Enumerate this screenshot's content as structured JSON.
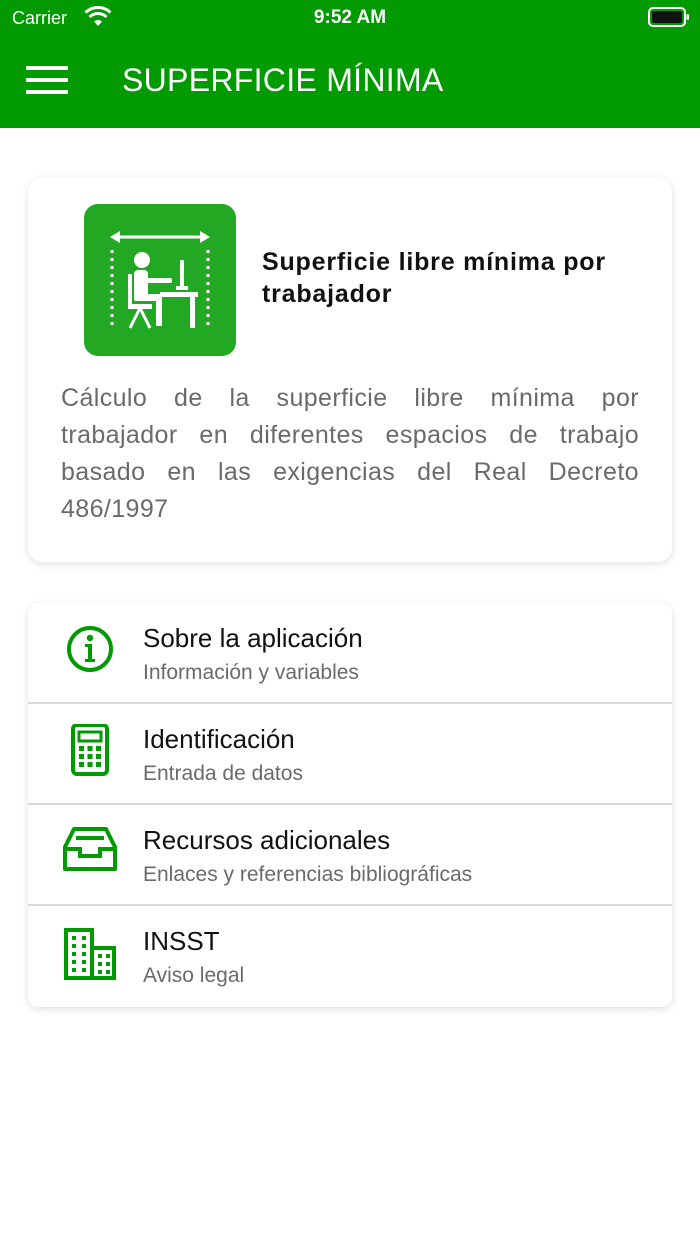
{
  "status_bar": {
    "carrier": "Carrier",
    "time": "9:52 AM"
  },
  "header": {
    "title": "SUPERFICIE MÍNIMA"
  },
  "colors": {
    "brand": "#019a01",
    "icon_green": "#22a822"
  },
  "card": {
    "icon": "workstation-space-icon",
    "title": "Superficie libre mínima por trabajador",
    "description": "Cálculo de la superficie libre mínima por trabajador en diferentes espacios de trabajo basado en las exigencias del Real Decreto 486/1997"
  },
  "menu": {
    "items": [
      {
        "icon": "info-icon",
        "title": "Sobre la aplicación",
        "subtitle": "Información y variables"
      },
      {
        "icon": "calculator-icon",
        "title": "Identificación",
        "subtitle": "Entrada de datos"
      },
      {
        "icon": "inbox-tray-icon",
        "title": "Recursos adicionales",
        "subtitle": "Enlaces y referencias bibliográficas"
      },
      {
        "icon": "building-icon",
        "title": "INSST",
        "subtitle": "Aviso legal"
      }
    ]
  }
}
